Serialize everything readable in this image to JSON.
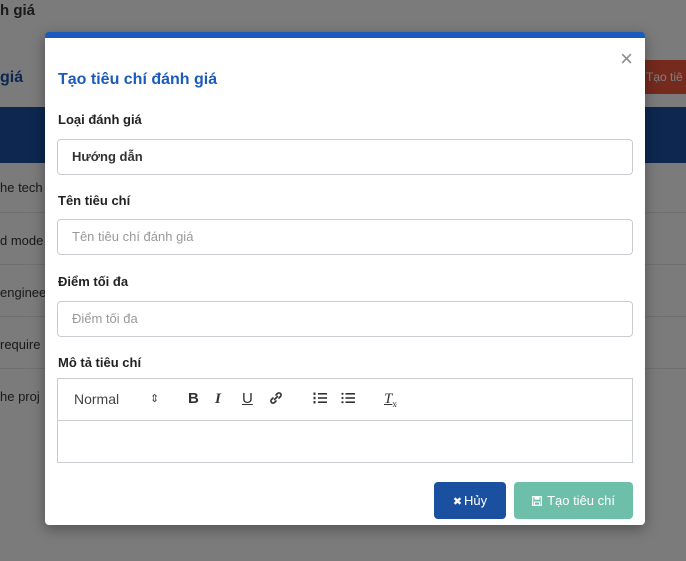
{
  "background": {
    "title": "h giá",
    "subtitle": "giá",
    "create_button": "Tạo tiê",
    "rows": [
      "he tech",
      "d mode",
      "enginee",
      "require",
      "he proj"
    ]
  },
  "modal": {
    "title": "Tạo tiêu chí đánh giá",
    "close_icon": "×",
    "type_label": "Loại đánh giá",
    "type_value": "Hướng dẫn",
    "name_label": "Tên tiêu chí",
    "name_placeholder": "Tên tiêu chí đánh giá",
    "max_label": "Điểm tối đa",
    "max_placeholder": "Điểm tối đa",
    "desc_label": "Mô tả tiêu chí",
    "toolbar": {
      "format": "Normal",
      "format_arrows": "⇕",
      "bold": "B",
      "italic": "I",
      "underline": "U",
      "link": "🔗",
      "ordered_list": "☰",
      "bullet_list": "☰",
      "clear": "T"
    },
    "cancel_label": "Hủy",
    "cancel_icon": "✖",
    "create_label": "Tạo tiêu chí",
    "create_icon": "💾"
  },
  "colors": {
    "accent": "#1b5bbd",
    "cancel": "#1b4fa0",
    "create": "#6dbfa9"
  }
}
